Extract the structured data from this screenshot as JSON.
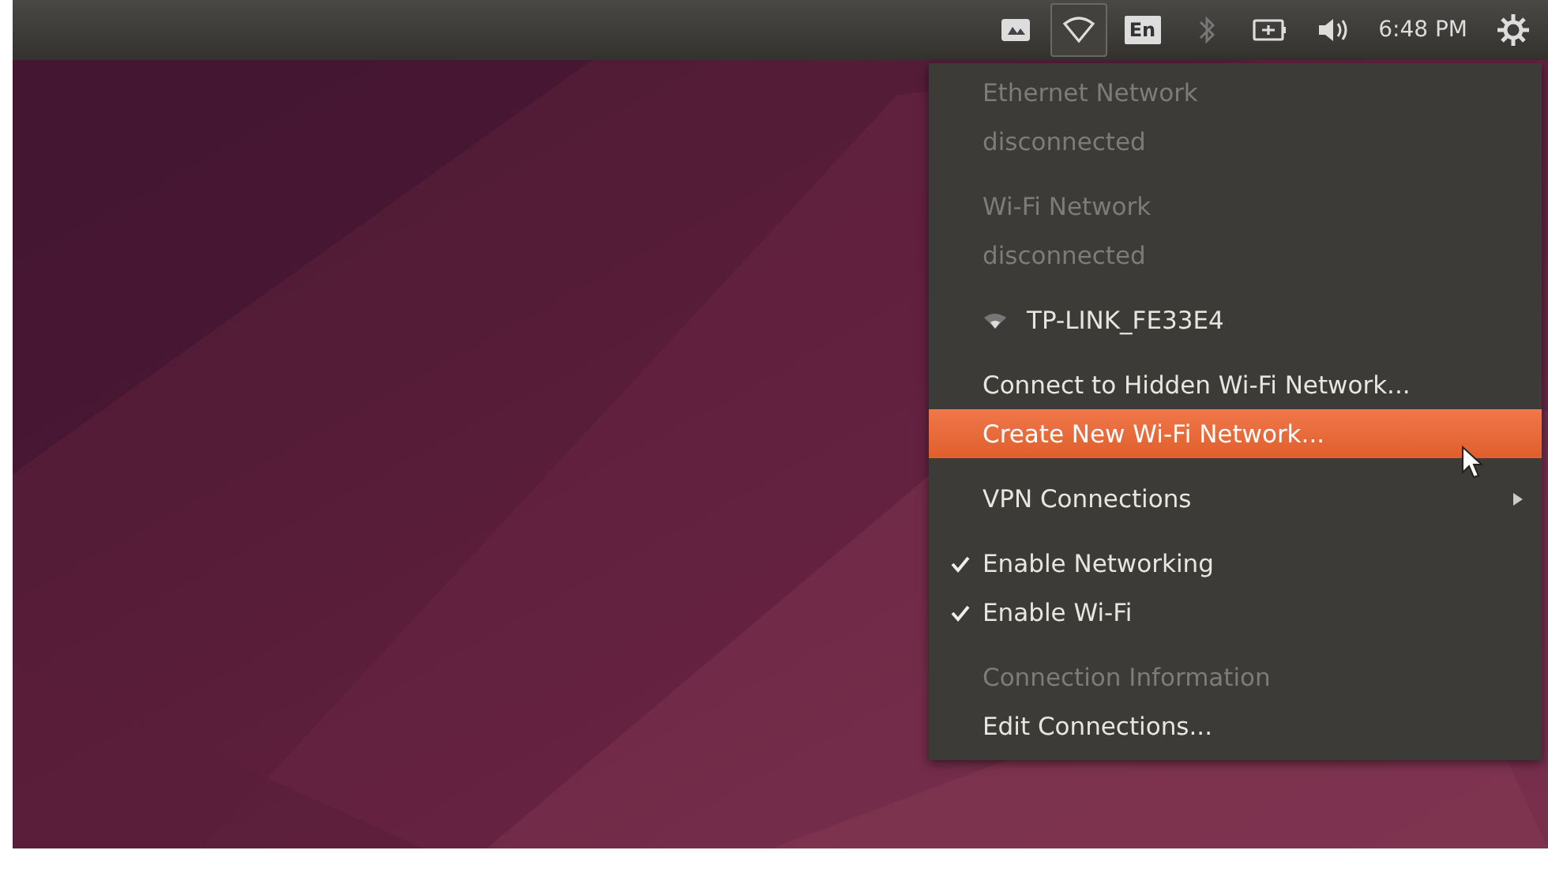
{
  "top_bar": {
    "indicators": [
      {
        "kind": "app",
        "selected": false
      },
      {
        "kind": "wifi",
        "selected": true
      },
      {
        "kind": "keyboard",
        "label": "En",
        "selected": false
      },
      {
        "kind": "bluetooth",
        "selected": false
      },
      {
        "kind": "battery",
        "selected": false
      },
      {
        "kind": "volume",
        "selected": false
      },
      {
        "kind": "clock",
        "label": "6:48 PM",
        "selected": false
      },
      {
        "kind": "gear",
        "selected": false
      }
    ]
  },
  "network_menu": {
    "items": [
      {
        "kind": "text",
        "label": "Ethernet Network",
        "disabled": true,
        "selected": false
      },
      {
        "kind": "text",
        "label": "disconnected",
        "disabled": true,
        "selected": false
      },
      {
        "kind": "separator"
      },
      {
        "kind": "text",
        "label": "Wi-Fi Network",
        "disabled": true,
        "selected": false
      },
      {
        "kind": "text",
        "label": "disconnected",
        "disabled": true,
        "selected": false
      },
      {
        "kind": "separator"
      },
      {
        "kind": "network",
        "label": "TP-LINK_FE33E4",
        "disabled": false,
        "selected": false
      },
      {
        "kind": "separator"
      },
      {
        "kind": "action",
        "label": "Connect to Hidden Wi-Fi Network...",
        "disabled": false,
        "selected": false
      },
      {
        "kind": "action",
        "label": "Create New Wi-Fi Network...",
        "disabled": false,
        "selected": true
      },
      {
        "kind": "separator"
      },
      {
        "kind": "submenu",
        "label": "VPN Connections",
        "disabled": false,
        "selected": false
      },
      {
        "kind": "separator"
      },
      {
        "kind": "check",
        "label": "Enable Networking",
        "checked": true,
        "disabled": false,
        "selected": false
      },
      {
        "kind": "check",
        "label": "Enable Wi-Fi",
        "checked": true,
        "disabled": false,
        "selected": false
      },
      {
        "kind": "separator"
      },
      {
        "kind": "action",
        "label": "Connection Information",
        "disabled": true,
        "selected": false
      },
      {
        "kind": "action",
        "label": "Edit Connections...",
        "disabled": false,
        "selected": false
      }
    ]
  }
}
